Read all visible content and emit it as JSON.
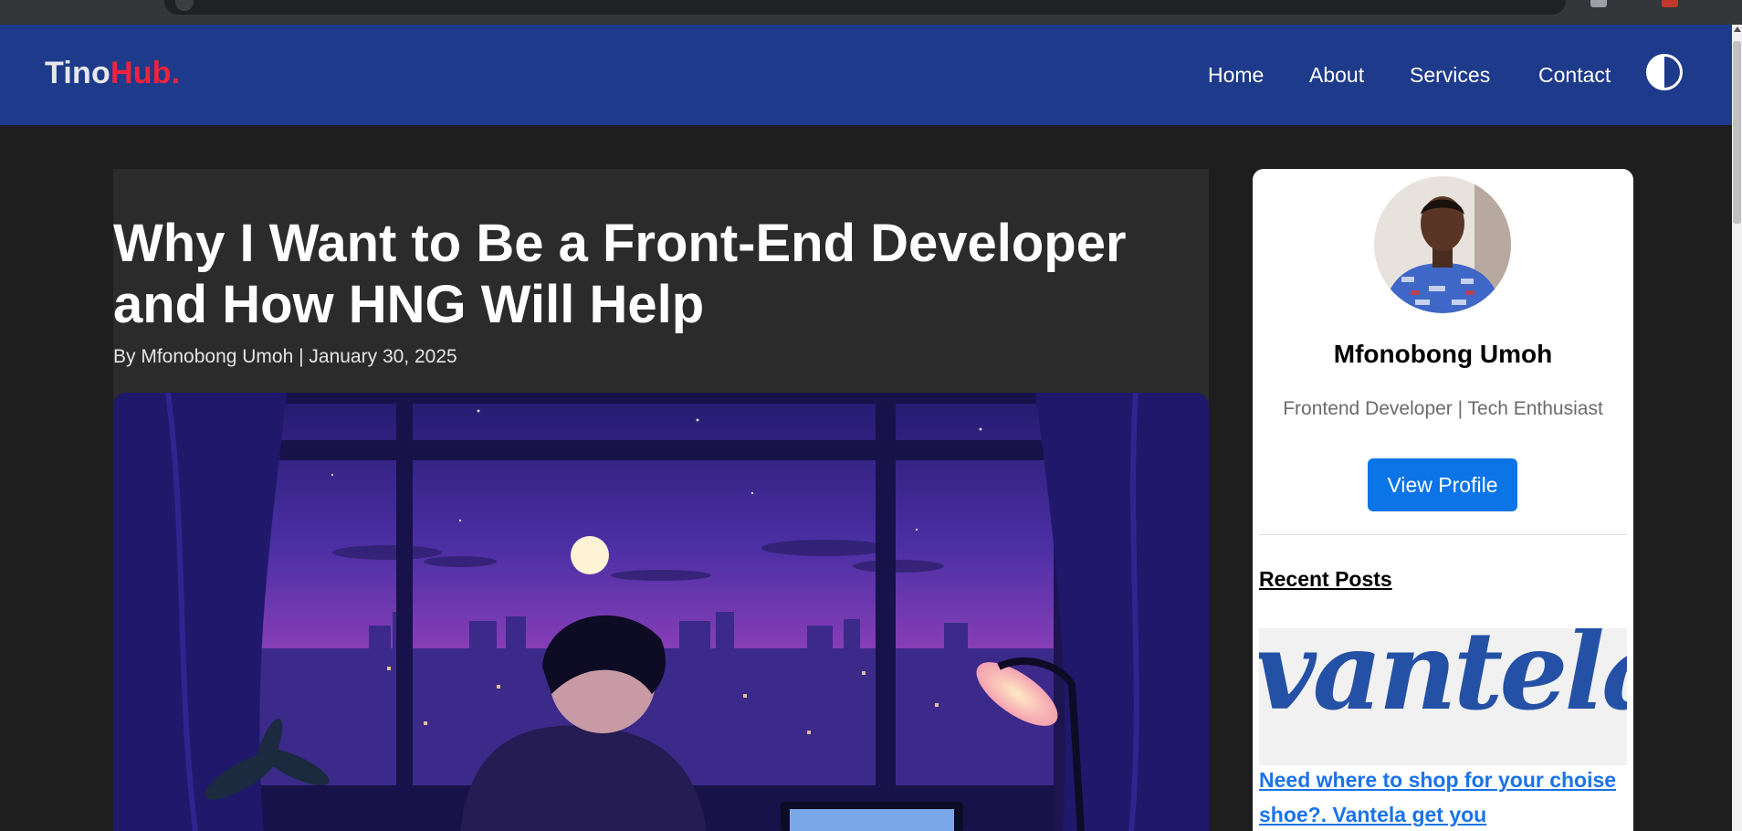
{
  "header": {
    "logo_primary": "Tino",
    "logo_accent": "Hub.",
    "nav": [
      "Home",
      "About",
      "Services",
      "Contact"
    ]
  },
  "article": {
    "title": "Why I Want to Be a Front-End Developer and How HNG Will Help",
    "byline": "By Mfonobong Umoh | January 30, 2025"
  },
  "sidebar": {
    "author_name": "Mfonobong Umoh",
    "author_role": "Frontend Developer | Tech Enthusiast",
    "view_profile_label": "View Profile",
    "recent_posts_title": "Recent Posts",
    "recent_post": {
      "image_logo_text": "vantela",
      "link_text": "Need where to shop for your choise shoe?. Vantela get you"
    }
  },
  "colors": {
    "header_bg": "#1e3a8a",
    "logo_accent": "#ef233c",
    "page_bg": "#1e1e1e",
    "article_bg": "#2b2b2b",
    "button_bg": "#0b74e6",
    "link": "#1a73e8"
  },
  "icons": {
    "theme_toggle": "half-circle-contrast-icon"
  }
}
